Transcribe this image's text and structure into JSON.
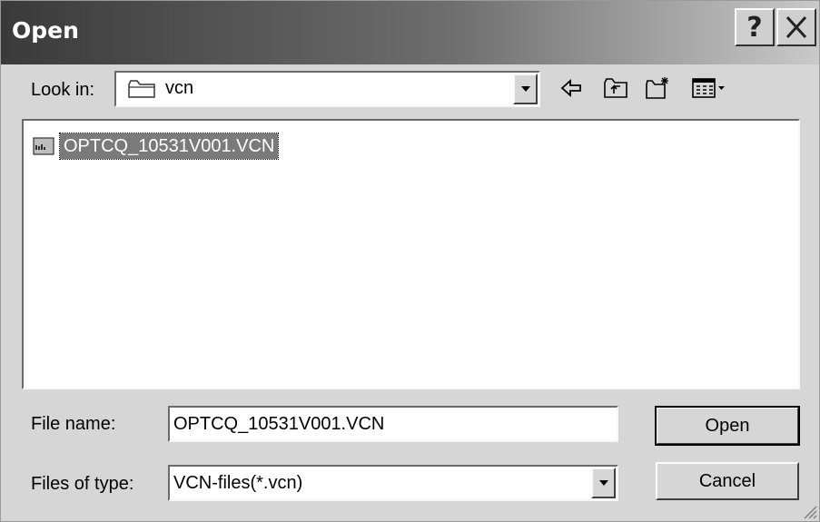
{
  "window": {
    "title": "Open"
  },
  "titlebar": {
    "help_glyph": "?",
    "help_icon": "help-icon",
    "close_icon": "close-icon"
  },
  "look_in": {
    "label": "Look in:",
    "value": "vcn",
    "folder_icon": "folder-icon"
  },
  "toolbar": {
    "icons": [
      "back-arrow-icon",
      "up-one-level-icon",
      "create-new-folder-icon",
      "view-menu-icon"
    ]
  },
  "files": [
    {
      "name": "OPTCQ_10531V001.VCN",
      "icon": "vcn-file-icon",
      "selected": true
    }
  ],
  "file_name": {
    "label": "File name:",
    "value": "OPTCQ_10531V001.VCN"
  },
  "file_type": {
    "label": "Files of type:",
    "value": "VCN-files(*.vcn)"
  },
  "buttons": {
    "open": "Open",
    "cancel": "Cancel"
  },
  "colors": {
    "selection": "#7a7a7a",
    "face": "#d6d6d6"
  }
}
